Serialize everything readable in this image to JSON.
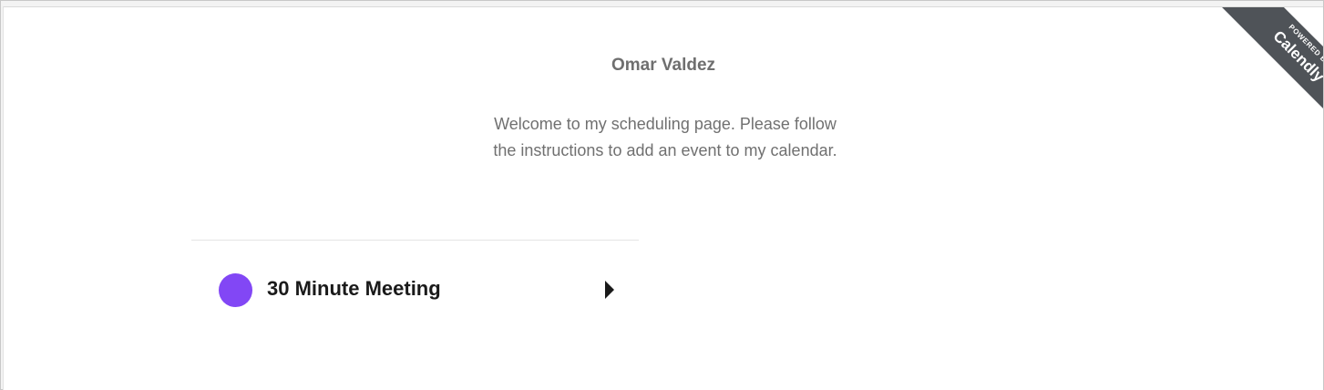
{
  "host": {
    "name": "Omar Valdez",
    "welcome": "Welcome to my scheduling page. Please follow the instructions to add an event to my calendar."
  },
  "events": [
    {
      "name": "30 Minute Meeting",
      "color": "#8247f5"
    }
  ],
  "branding": {
    "powered_by": "POWERED BY",
    "brand": "Calendly",
    "ribbon_color": "#4f5358"
  }
}
